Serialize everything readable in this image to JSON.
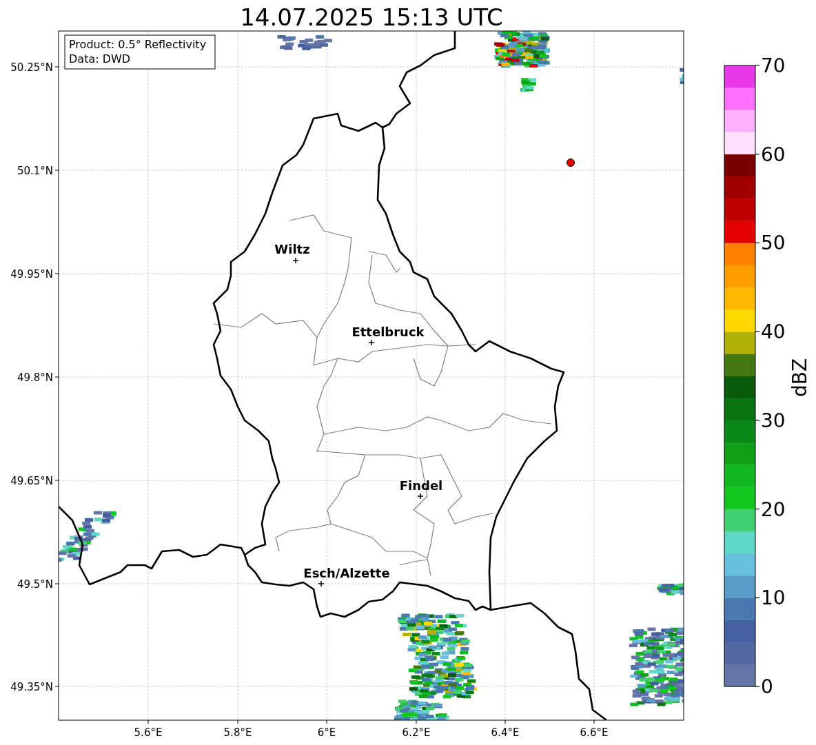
{
  "title": "14.07.2025 15:13 UTC",
  "info_box": [
    "Product: 0.5° Reflectivity",
    "Data: DWD"
  ],
  "map": {
    "lat_ticks": [
      "50.25°N",
      "50.1°N",
      "49.95°N",
      "49.8°N",
      "49.65°N",
      "49.5°N",
      "49.35°N"
    ],
    "lon_ticks": [
      "5.6°E",
      "5.8°E",
      "6°E",
      "6.2°E",
      "6.4°E",
      "6.6°E"
    ],
    "places": [
      {
        "label": "Wiltz"
      },
      {
        "label": "Ettelbruck"
      },
      {
        "label": "Findel"
      },
      {
        "label": "Esch/Alzette"
      }
    ]
  },
  "colorbar": {
    "label": "dBZ",
    "ticks": [
      "70",
      "60",
      "50",
      "40",
      "30",
      "20",
      "10",
      "0"
    ],
    "bands": [
      {
        "color": "#6675a8"
      },
      {
        "color": "#5468a0"
      },
      {
        "color": "#4560a0"
      },
      {
        "color": "#4a78b0"
      },
      {
        "color": "#5a9cc8"
      },
      {
        "color": "#66c0dc"
      },
      {
        "color": "#60d8c8"
      },
      {
        "color": "#40d070"
      },
      {
        "color": "#10c820"
      },
      {
        "color": "#10b820"
      },
      {
        "color": "#10a018"
      },
      {
        "color": "#0c8818"
      },
      {
        "color": "#0a7412"
      },
      {
        "color": "#0a5a0c"
      },
      {
        "color": "#447810"
      },
      {
        "color": "#b0b008"
      },
      {
        "color": "#ffd800"
      },
      {
        "color": "#ffb800"
      },
      {
        "color": "#ff9c00"
      },
      {
        "color": "#ff8000"
      },
      {
        "color": "#e40000"
      },
      {
        "color": "#c00000"
      },
      {
        "color": "#a00000"
      },
      {
        "color": "#780000"
      },
      {
        "color": "#ffe0ff"
      },
      {
        "color": "#ffb0ff"
      },
      {
        "color": "#ff70ff"
      },
      {
        "color": "#e838e8"
      }
    ]
  }
}
